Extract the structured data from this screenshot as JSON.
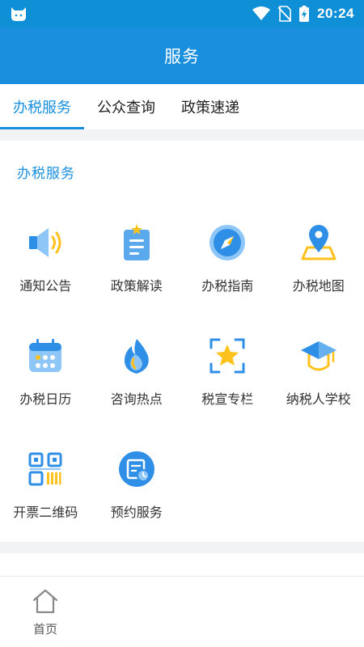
{
  "status_bar": {
    "time": "20:24"
  },
  "header": {
    "title": "服务"
  },
  "tabs": [
    {
      "label": "办税服务",
      "active": true
    },
    {
      "label": "公众查询",
      "active": false
    },
    {
      "label": "政策速递",
      "active": false
    }
  ],
  "section": {
    "title": "办税服务",
    "items": [
      {
        "label": "通知公告",
        "icon": "speaker-icon"
      },
      {
        "label": "政策解读",
        "icon": "document-icon"
      },
      {
        "label": "办税指南",
        "icon": "compass-icon"
      },
      {
        "label": "办税地图",
        "icon": "map-pin-icon"
      },
      {
        "label": "办税日历",
        "icon": "calendar-icon"
      },
      {
        "label": "咨询热点",
        "icon": "flame-phone-icon"
      },
      {
        "label": "税宣专栏",
        "icon": "star-frame-icon"
      },
      {
        "label": "纳税人学校",
        "icon": "graduation-cap-icon"
      },
      {
        "label": "开票二维码",
        "icon": "qr-code-icon"
      },
      {
        "label": "预约服务",
        "icon": "appointment-icon"
      }
    ]
  },
  "bottom_nav": {
    "home_label": "首页"
  },
  "colors": {
    "primary": "#1a8fde",
    "icon_light": "#8ec7f7",
    "icon_accent": "#ffc21c"
  }
}
